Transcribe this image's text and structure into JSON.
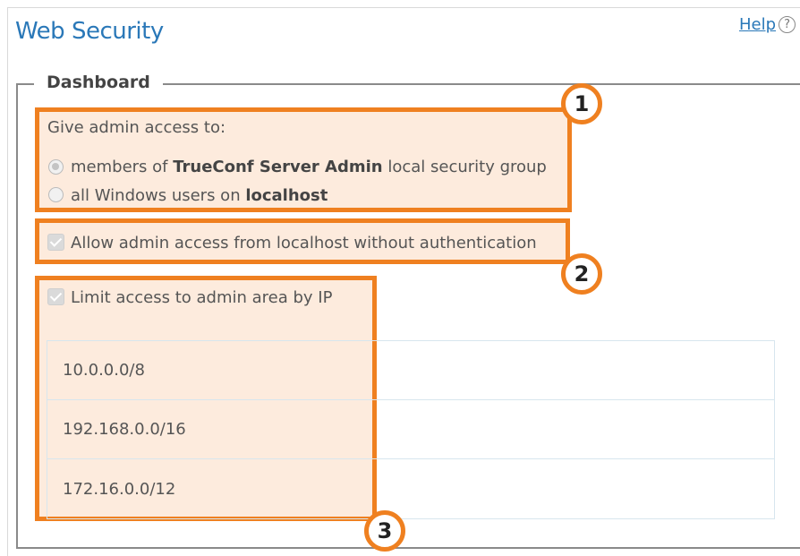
{
  "header": {
    "title": "Web Security",
    "help_label": "Help",
    "help_icon_glyph": "?"
  },
  "dashboard": {
    "legend": "Dashboard",
    "admin_access": {
      "label": "Give admin access to:",
      "option1_pre": "members of ",
      "option1_bold": "TrueConf Server Admin",
      "option1_post": " local security group",
      "option2_pre": "all Windows users on ",
      "option2_bold": "localhost",
      "selected": "option1"
    },
    "localhost_access": {
      "label": "Allow admin access from localhost without authentication",
      "checked": true
    },
    "limit_ip": {
      "label": "Limit access to admin area by IP",
      "checked": true
    },
    "ip_list": [
      "10.0.0.0/8",
      "192.168.0.0/16",
      "172.16.0.0/12"
    ]
  },
  "callouts": [
    "1",
    "2",
    "3"
  ],
  "colors": {
    "accent": "#ef8020",
    "highlight_fill": "#fdebdd",
    "title_blue": "#2a78b8"
  }
}
